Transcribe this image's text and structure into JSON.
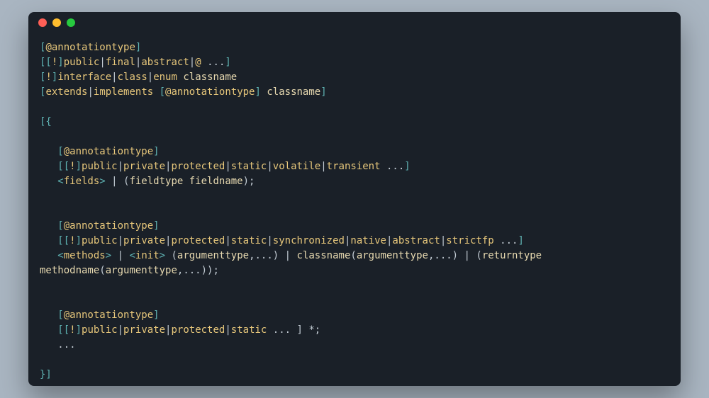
{
  "colors": {
    "bg_page": "#a9b5c1",
    "bg_window": "#1a2028",
    "btn_red": "#ff5f56",
    "btn_yellow": "#ffbd2e",
    "btn_green": "#27c93f",
    "teal": "#5fb3b3",
    "yellow": "#e7c77b",
    "cream": "#e7d9b0",
    "gray": "#c3ccd4"
  },
  "code": {
    "l1": {
      "a": "[",
      "b": "@annotationtype",
      "c": "]"
    },
    "l2": {
      "a": "[[",
      "b": "!",
      "c": "]",
      "d": "public",
      "e": "|",
      "f": "final",
      "g": "|",
      "h": "abstract",
      "i": "|",
      "j": "@",
      "k": " ...",
      "l": "]"
    },
    "l3": {
      "a": "[",
      "b": "!",
      "c": "]",
      "d": "interface",
      "e": "|",
      "f": "class",
      "g": "|",
      "h": "enum",
      "i": " classname"
    },
    "l4": {
      "a": "[",
      "b": "extends",
      "c": "|",
      "d": "implements",
      "e": " [",
      "f": "@annotationtype",
      "g": "]",
      "h": " classname",
      "i": "]"
    },
    "l5": "",
    "l6": {
      "a": "[{"
    },
    "l7": "",
    "l8": {
      "a": "[",
      "b": "@annotationtype",
      "c": "]"
    },
    "l9": {
      "a": "[[",
      "b": "!",
      "c": "]",
      "d": "public",
      "e": "|",
      "f": "private",
      "g": "|",
      "h": "protected",
      "i": "|",
      "j": "static",
      "k": "|",
      "l": "volatile",
      "m": "|",
      "n": "transient",
      "o": " ...",
      "p": "]"
    },
    "l10": {
      "a": "<",
      "b": "fields",
      "c": ">",
      "d": " | (",
      "e": "fieldtype fieldname",
      "f": ");"
    },
    "l11": "",
    "l12": "",
    "l13": {
      "a": "[",
      "b": "@annotationtype",
      "c": "]"
    },
    "l14": {
      "a": "[[",
      "b": "!",
      "c": "]",
      "d": "public",
      "e": "|",
      "f": "private",
      "g": "|",
      "h": "protected",
      "i": "|",
      "j": "static",
      "k": "|",
      "l": "synchronized",
      "m": "|",
      "n": "native",
      "o": "|",
      "p": "abstract",
      "q": "|",
      "r": "strictfp",
      "s": " ...",
      "t": "]"
    },
    "l15": {
      "a": "<",
      "b": "methods",
      "c": ">",
      "d": " | ",
      "e": "<",
      "f": "init",
      "g": ">",
      "h": " (",
      "i": "argumenttype",
      "j": ",...) | ",
      "k": "classname",
      "l": "(",
      "m": "argumenttype",
      "n": ",...) | (",
      "o": "returntype"
    },
    "l16": {
      "a": "methodname",
      "b": "(",
      "c": "argumenttype",
      "d": ",...));"
    },
    "l17": "",
    "l18": "",
    "l19": {
      "a": "[",
      "b": "@annotationtype",
      "c": "]"
    },
    "l20": {
      "a": "[[",
      "b": "!",
      "c": "]",
      "d": "public",
      "e": "|",
      "f": "private",
      "g": "|",
      "h": "protected",
      "i": "|",
      "j": "static",
      "k": " ... ] *;"
    },
    "l21": {
      "a": "..."
    },
    "l22": "",
    "l23": {
      "a": "}]"
    }
  }
}
